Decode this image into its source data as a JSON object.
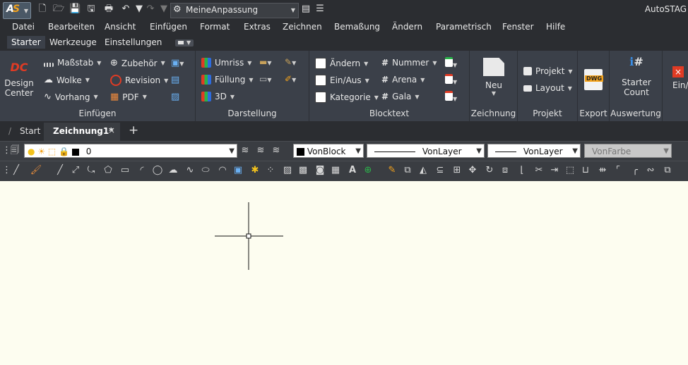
{
  "titlebar": {
    "workspace": "MeineAnpassung",
    "app_title": "AutoSTAG"
  },
  "menu": [
    "Datei",
    "Bearbeiten",
    "Ansicht",
    "Einfügen",
    "Format",
    "Extras",
    "Zeichnen",
    "Bemaßung",
    "Ändern",
    "Parametrisch",
    "Fenster",
    "Hilfe"
  ],
  "ribbon_tabs": [
    "Starter",
    "Werkzeuge",
    "Einstellungen"
  ],
  "ribbon": {
    "einfuegen": {
      "label": "Einfügen",
      "design_center_1": "Design",
      "design_center_2": "Center",
      "massstab": "Maßstab",
      "wolke": "Wolke",
      "vorhang": "Vorhang",
      "zubehoer": "Zubehör",
      "revision": "Revision",
      "pdf": "PDF"
    },
    "darstellung": {
      "label": "Darstellung",
      "umriss": "Umriss",
      "fuellung": "Füllung",
      "d3": "3D"
    },
    "blocktext": {
      "label": "Blocktext",
      "aendern": "Ändern",
      "einaus": "Ein/Aus",
      "kategorie": "Kategorie",
      "nummer": "Nummer",
      "arena": "Arena",
      "gala": "Gala"
    },
    "zeichnung": {
      "label": "Zeichnung",
      "neu": "Neu"
    },
    "projekt": {
      "label": "Projekt",
      "projekt": "Projekt",
      "layout": "Layout"
    },
    "export": {
      "label": "Export",
      "dwg": "DWG"
    },
    "auswertung": {
      "label": "Auswertung",
      "starter": "Starter",
      "count": "Count"
    },
    "einaus_cut": "Ein/"
  },
  "doc_tabs": {
    "start": "Start",
    "active": "Zeichnung1*"
  },
  "layerbar": {
    "layer_value": "0",
    "color": "VonBlock",
    "linetype": "VonLayer",
    "lineweight": "VonLayer",
    "plotstyle": "VonFarbe"
  },
  "colors": {
    "bg_dark": "#2b2d31",
    "ribbon": "#3b4049",
    "canvas": "#fdfdf0",
    "accent_red": "#e03b24"
  }
}
